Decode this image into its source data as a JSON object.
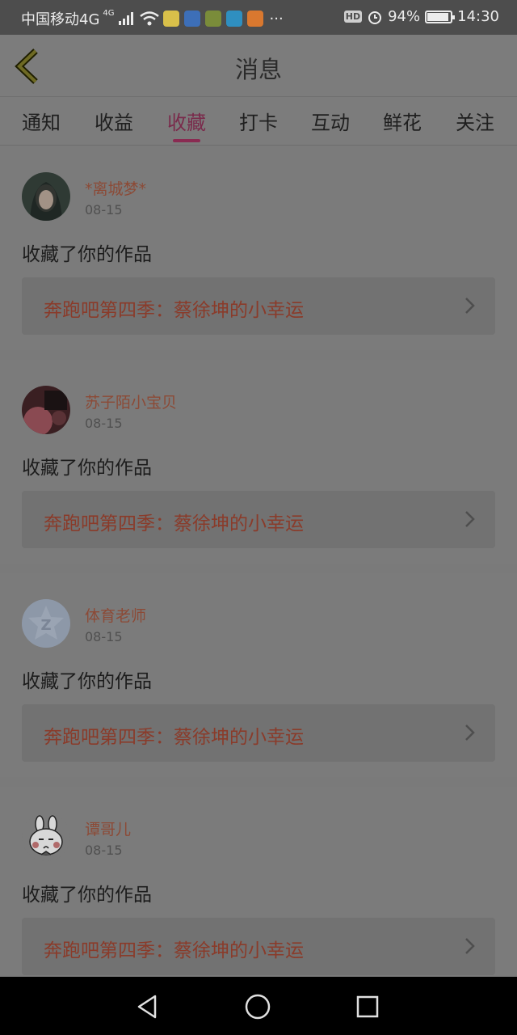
{
  "status": {
    "carrier": "中国移动4G",
    "net_badge": "4G",
    "hd": "HD",
    "battery_pct": "94%",
    "battery_level": 0.94,
    "time": "14:30",
    "more": "···",
    "app_icons": [
      "app-icon-1",
      "baidu-icon",
      "app-icon-3",
      "app-icon-4",
      "uc-icon"
    ],
    "app_colors": [
      "#d9c04a",
      "#3d6fb8",
      "#7a8c3a",
      "#2f8fc0",
      "#d9782f"
    ]
  },
  "header": {
    "title": "消息"
  },
  "tabs": [
    {
      "label": "通知",
      "active": false
    },
    {
      "label": "收益",
      "active": false
    },
    {
      "label": "收藏",
      "active": true
    },
    {
      "label": "打卡",
      "active": false
    },
    {
      "label": "互动",
      "active": false
    },
    {
      "label": "鲜花",
      "active": false
    },
    {
      "label": "关注",
      "active": false
    }
  ],
  "items": [
    {
      "user": "*离城梦*",
      "date": "08-15",
      "action": "收藏了你的作品",
      "work": "奔跑吧第四季：蔡徐坤的小幸运",
      "avatar": "photo-dark"
    },
    {
      "user": "苏子陌小宝贝",
      "date": "08-15",
      "action": "收藏了你的作品",
      "work": "奔跑吧第四季：蔡徐坤的小幸运",
      "avatar": "photo-red"
    },
    {
      "user": "体育老师",
      "date": "08-15",
      "action": "收藏了你的作品",
      "work": "奔跑吧第四季：蔡徐坤的小幸运",
      "avatar": "default-star"
    },
    {
      "user": "谭哥儿",
      "date": "08-15",
      "action": "收藏了你的作品",
      "work": "奔跑吧第四季：蔡徐坤的小幸运",
      "avatar": "cartoon-rabbit"
    }
  ],
  "colors": {
    "overlay": "#7a7a7a",
    "accent": "#8a2b52",
    "username": "#8c4a36",
    "work_title": "#8a3b2a"
  }
}
